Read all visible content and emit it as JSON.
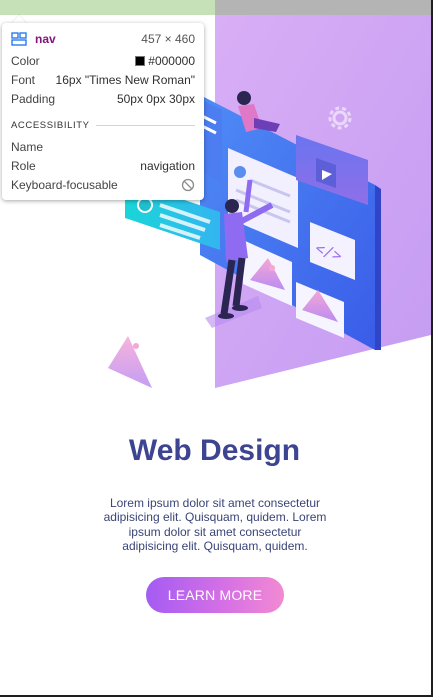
{
  "colors": {
    "hero_purple": "#cfa3f4",
    "title": "#3d4592",
    "text": "#3a4478",
    "button_start": "#a45cf2",
    "button_end": "#f28ad2"
  },
  "hero": {
    "illustration": "web-design-illustration"
  },
  "content": {
    "title": "Web Design",
    "description": "Lorem ipsum dolor sit amet consectetur adipisicing elit. Quisquam, quidem. Lorem ipsum dolor sit amet consectetur adipisicing elit. Quisquam, quidem.",
    "button_label": "LEARN MORE"
  },
  "inspector": {
    "element_icon": "layout-icon",
    "tag": "nav",
    "dimensions": "457 × 460",
    "rows": [
      {
        "label": "Color",
        "value": "#000000"
      },
      {
        "label": "Font",
        "value": "16px \"Times New Roman\""
      },
      {
        "label": "Padding",
        "value": "50px 0px 30px"
      }
    ],
    "section_title": "ACCESSIBILITY",
    "a11y_rows": [
      {
        "label": "Name",
        "value": ""
      },
      {
        "label": "Role",
        "value": "navigation"
      },
      {
        "label": "Keyboard-focusable",
        "value": ""
      }
    ],
    "keyboard_icon": "not-allowed-icon"
  }
}
